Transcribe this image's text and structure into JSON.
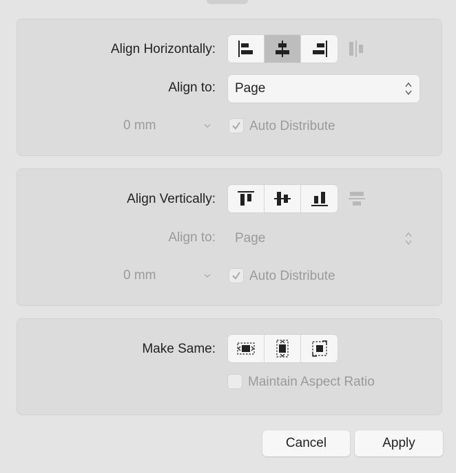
{
  "horizontal": {
    "label": "Align Horizontally:",
    "align_to_label": "Align to:",
    "align_to_value": "Page",
    "spacing_value": "0 mm",
    "auto_distribute_label": "Auto Distribute",
    "auto_distribute_checked": true,
    "active_button": "center"
  },
  "vertical": {
    "label": "Align Vertically:",
    "align_to_label": "Align to:",
    "align_to_value": "Page",
    "spacing_value": "0 mm",
    "auto_distribute_label": "Auto Distribute",
    "auto_distribute_checked": true
  },
  "make_same": {
    "label": "Make Same:",
    "maintain_aspect_label": "Maintain Aspect Ratio",
    "maintain_aspect_checked": false
  },
  "buttons": {
    "cancel": "Cancel",
    "apply": "Apply"
  },
  "icons": {
    "h_left": "align-left-icon",
    "h_center": "align-center-horizontal-icon",
    "h_right": "align-right-icon",
    "h_distribute": "distribute-horizontal-icon",
    "v_top": "align-top-icon",
    "v_middle": "align-middle-vertical-icon",
    "v_bottom": "align-bottom-icon",
    "v_distribute": "distribute-vertical-icon",
    "same_width": "same-width-icon",
    "same_height": "same-height-icon",
    "same_size": "same-size-icon"
  },
  "colors": {
    "panel": "#dcdcdc",
    "dialog": "#e4e4e4",
    "active_segment": "#bdbdbd",
    "disabled_text": "#9a9a9a"
  }
}
